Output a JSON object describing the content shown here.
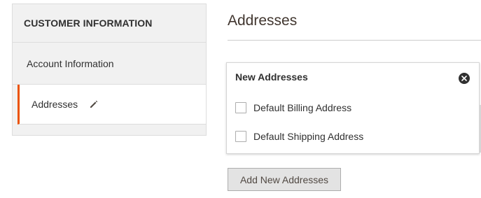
{
  "sidebar": {
    "title": "CUSTOMER INFORMATION",
    "items": [
      {
        "label": "Account Information"
      },
      {
        "label": "Addresses",
        "active": true,
        "icon": "pencil-icon"
      }
    ],
    "accent_color": "#eb5202"
  },
  "main": {
    "title": "Addresses",
    "panel": {
      "header": "New Addresses",
      "close_icon": "close-icon",
      "checkboxes": [
        {
          "label": "Default Billing Address",
          "checked": false
        },
        {
          "label": "Default Shipping Address",
          "checked": false
        }
      ]
    },
    "add_button_label": "Add New Addresses"
  }
}
